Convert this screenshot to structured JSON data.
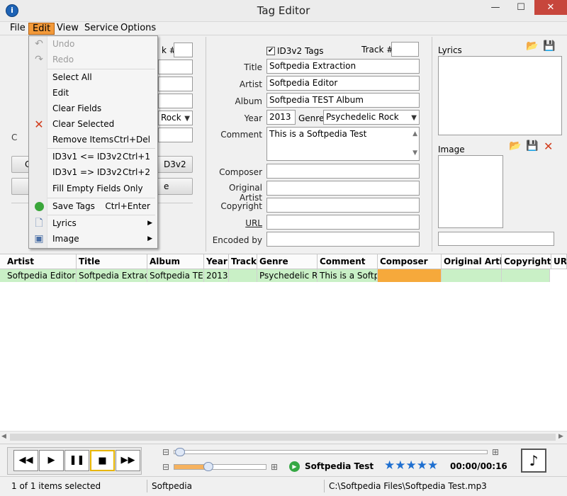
{
  "window": {
    "title": "Tag Editor",
    "app_icon": "info-icon",
    "close_glyph": "✕",
    "minimize_glyph": "—",
    "maximize_glyph": "☐"
  },
  "menu": [
    "File",
    "Edit",
    "View",
    "Service",
    "Options"
  ],
  "edit_menu": {
    "undo": "Undo",
    "redo": "Redo",
    "select_all": "Select All",
    "edit": "Edit",
    "clear_fields": "Clear Fields",
    "clear_selected": "Clear Selected",
    "remove_items": "Remove Items",
    "remove_items_shortcut": "Ctrl+Del",
    "id3v1_from_v2": "ID3v1 <= ID3v2",
    "id3v1_from_v2_shortcut": "Ctrl+1",
    "id3v1_to_v2": "ID3v1 => ID3v2",
    "id3v1_to_v2_shortcut": "Ctrl+2",
    "fill_empty": "Fill Empty Fields Only",
    "save_tags": "Save Tags",
    "save_tags_shortcut": "Ctrl+Enter",
    "lyrics": "Lyrics",
    "image": "Image"
  },
  "left_panel": {
    "track_label_partial": "k #",
    "genre_partial": "Rock",
    "button_partial": "D3v2",
    "button2_partial": "e",
    "button_left_partial": "C"
  },
  "id3v2": {
    "checkbox_label": "ID3v2 Tags",
    "checked": true,
    "track_label": "Track #",
    "track": "",
    "title_label": "Title",
    "title": "Softpedia Extraction",
    "artist_label": "Artist",
    "artist": "Softpedia Editor",
    "album_label": "Album",
    "album": "Softpedia TEST Album",
    "year_label": "Year",
    "year": "2013",
    "genre_label": "Genre",
    "genre": "Psychedelic Rock",
    "comment_label": "Comment",
    "comment": "This is a Softpedia Test",
    "composer_label": "Composer",
    "composer": "",
    "original_artist_label": "Original Artist",
    "original_artist": "",
    "copyright_label": "Copyright",
    "copyright": "",
    "url_label": "URL",
    "url": "",
    "encoded_by_label": "Encoded by",
    "encoded_by": ""
  },
  "right_panel": {
    "lyrics_label": "Lyrics",
    "image_label": "Image"
  },
  "grid": {
    "headers": [
      "Artist",
      "Title",
      "Album",
      "Year",
      "Track",
      "Genre",
      "Comment",
      "Composer",
      "Original Artist",
      "Copyright",
      "UR"
    ],
    "row": [
      "Softpedia Editor",
      "Softpedia Extraction",
      "Softpedia TEST",
      "2013",
      "",
      "Psychedelic Rock",
      "This is a Softped",
      "",
      "",
      "",
      ""
    ],
    "highlight_color": "#c9f0c6",
    "composer_color": "#f6a93b"
  },
  "player": {
    "now_playing": "Softpedia Test",
    "time": "00:00/00:16",
    "rating_stars": 5
  },
  "status": {
    "selected": "1 of 1 items selected",
    "author": "Softpedia",
    "path": "C:\\Softpedia Files\\Softpedia Test.mp3"
  }
}
